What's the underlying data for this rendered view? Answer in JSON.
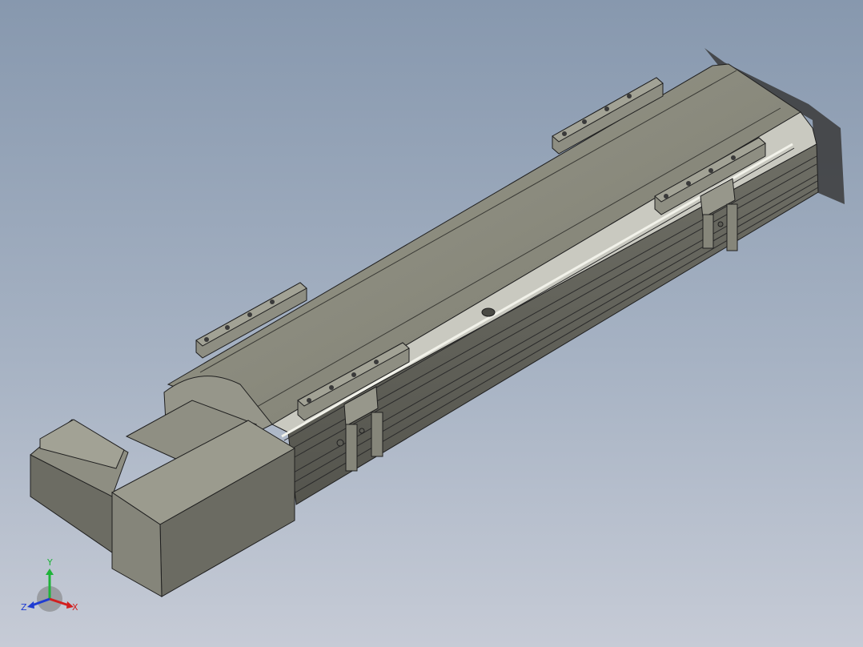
{
  "viewport": {
    "background_top": "#8798ae",
    "background_bottom": "#c6cbd6"
  },
  "model": {
    "body_color": "#8c8c80",
    "shade_dark": "#5f5f58",
    "shade_light": "#a4a497",
    "edge_color": "#1f1f1f"
  },
  "triad": {
    "x_label": "X",
    "y_label": "Y",
    "z_label": "Z",
    "x_color": "#d21f1f",
    "y_color": "#1fb33a",
    "z_color": "#1f3cd2"
  }
}
